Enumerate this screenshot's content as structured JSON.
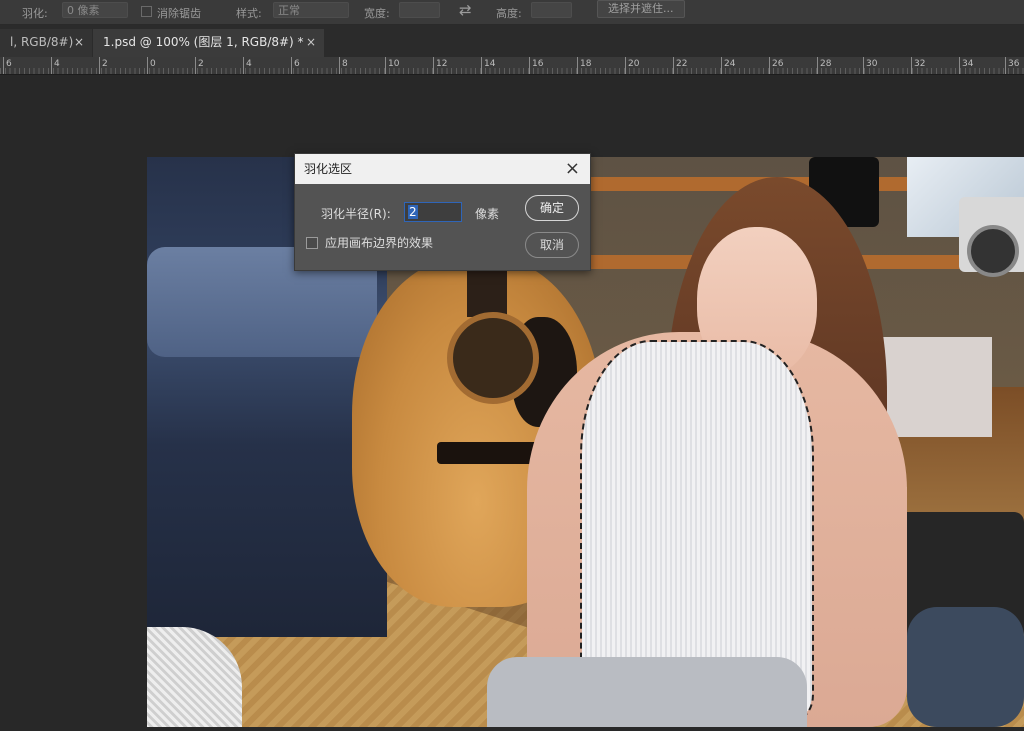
{
  "optbar": {
    "feather_label": "羽化:",
    "feather_value": "0 像素",
    "antialias_label": "消除锯齿",
    "style_label": "样式:",
    "style_value": "正常",
    "width_label": "宽度:",
    "height_label": "高度:",
    "select_mask_label": "选择并遮住..."
  },
  "tabs": [
    {
      "label": "l, RGB/8#) *"
    },
    {
      "label": "1.psd @ 100% (图层 1, RGB/8#) *"
    }
  ],
  "tab_close": "×",
  "ruler": [
    "6",
    "4",
    "2",
    "0",
    "2",
    "4",
    "6",
    "8",
    "10",
    "12",
    "14",
    "16",
    "18",
    "20",
    "22",
    "24",
    "26",
    "28",
    "30",
    "32",
    "34",
    "36"
  ],
  "dialog": {
    "title": "羽化选区",
    "close": "×",
    "radius_label": "羽化半径(R):",
    "radius_value": "2",
    "unit": "像素",
    "checkbox_label": "应用画布边界的效果",
    "ok": "确定",
    "cancel": "取消"
  }
}
